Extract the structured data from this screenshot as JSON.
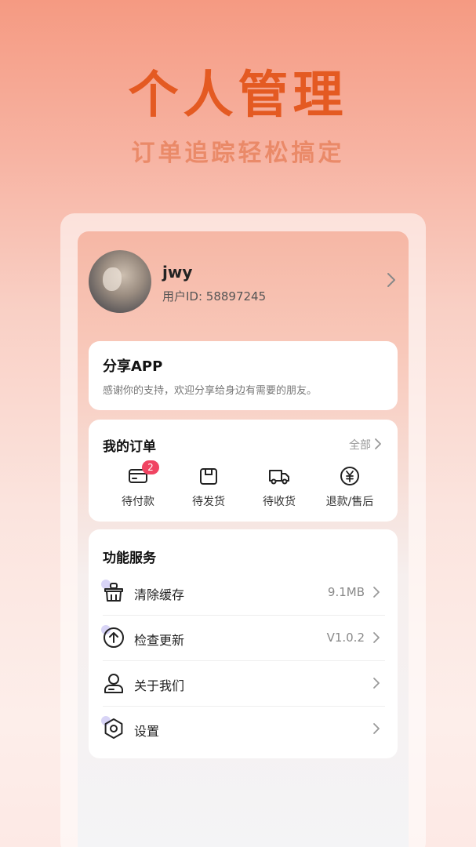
{
  "hero": {
    "title": "个人管理",
    "subtitle": "订单追踪轻松搞定"
  },
  "profile": {
    "username": "jwy",
    "user_id": "用户ID: 58897245"
  },
  "share": {
    "title": "分享APP",
    "desc": "感谢你的支持，欢迎分享给身边有需要的朋友。"
  },
  "orders": {
    "title": "我的订单",
    "all_label": "全部",
    "items": [
      {
        "label": "待付款",
        "icon": "card-icon",
        "badge": "2"
      },
      {
        "label": "待发货",
        "icon": "box-icon"
      },
      {
        "label": "待收货",
        "icon": "truck-icon"
      },
      {
        "label": "退款/售后",
        "icon": "yen-icon"
      }
    ]
  },
  "services": {
    "title": "功能服务",
    "items": [
      {
        "label": "清除缓存",
        "value": "9.1MB",
        "icon": "broom-icon"
      },
      {
        "label": "检查更新",
        "value": "V1.0.2",
        "icon": "upload-icon"
      },
      {
        "label": "关于我们",
        "value": "",
        "icon": "user-icon"
      },
      {
        "label": "设置",
        "value": "",
        "icon": "settings-icon"
      }
    ]
  },
  "colors": {
    "hero_title": "#e45a22",
    "badge": "#f04462"
  }
}
